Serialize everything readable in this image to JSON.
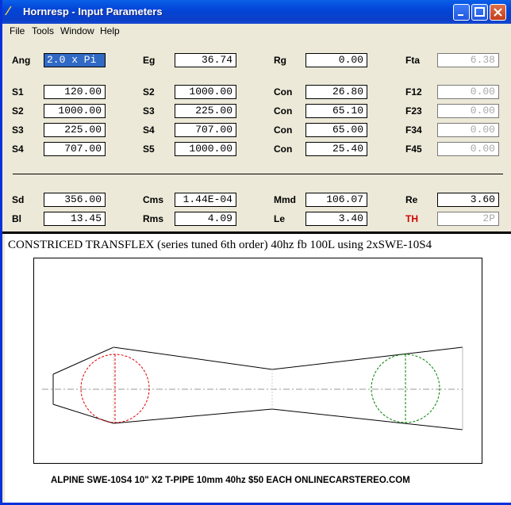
{
  "window": {
    "title": "Hornresp - Input Parameters"
  },
  "menu": [
    "File",
    "Tools",
    "Window",
    "Help"
  ],
  "params": {
    "Ang": {
      "label": "Ang",
      "value": "2.0 x Pi"
    },
    "Eg": {
      "label": "Eg",
      "value": "36.74"
    },
    "Rg": {
      "label": "Rg",
      "value": "0.00"
    },
    "Fta": {
      "label": "Fta",
      "value": "6.38"
    },
    "S1a": {
      "label": "S1",
      "value": "120.00"
    },
    "S2a": {
      "label": "S2",
      "value": "1000.00"
    },
    "Con1": {
      "label": "Con",
      "value": "26.80"
    },
    "F12": {
      "label": "F12",
      "value": "0.00"
    },
    "S2b": {
      "label": "S2",
      "value": "1000.00"
    },
    "S3a": {
      "label": "S3",
      "value": "225.00"
    },
    "Con2": {
      "label": "Con",
      "value": "65.10"
    },
    "F23": {
      "label": "F23",
      "value": "0.00"
    },
    "S3b": {
      "label": "S3",
      "value": "225.00"
    },
    "S4a": {
      "label": "S4",
      "value": "707.00"
    },
    "Con3": {
      "label": "Con",
      "value": "65.00"
    },
    "F34": {
      "label": "F34",
      "value": "0.00"
    },
    "S4b": {
      "label": "S4",
      "value": "707.00"
    },
    "S5": {
      "label": "S5",
      "value": "1000.00"
    },
    "Con4": {
      "label": "Con",
      "value": "25.40"
    },
    "F45": {
      "label": "F45",
      "value": "0.00"
    },
    "Sd": {
      "label": "Sd",
      "value": "356.00"
    },
    "Cms": {
      "label": "Cms",
      "value": "1.44E-04"
    },
    "Mmd": {
      "label": "Mmd",
      "value": "106.07"
    },
    "Re": {
      "label": "Re",
      "value": "3.60"
    },
    "Bl": {
      "label": "Bl",
      "value": "13.45"
    },
    "Rms": {
      "label": "Rms",
      "value": "4.09"
    },
    "Le": {
      "label": "Le",
      "value": "3.40"
    },
    "TH": {
      "label": "TH",
      "value": "2P"
    }
  },
  "drawing": {
    "headline": "CONSTRICED TRANSFLEX (series tuned 6th order) 40hz fb  100L using 2xSWE-10S4",
    "caption": "ALPINE SWE-10S4 10\" X2 T-PIPE 10mm 40hz        $50 EACH ONLINECARSTEREO.COM"
  },
  "colors": {
    "accent_red": "#d00000",
    "driver_red": "#e00000",
    "driver_green": "#008000",
    "titlebar": "#0345d8"
  }
}
